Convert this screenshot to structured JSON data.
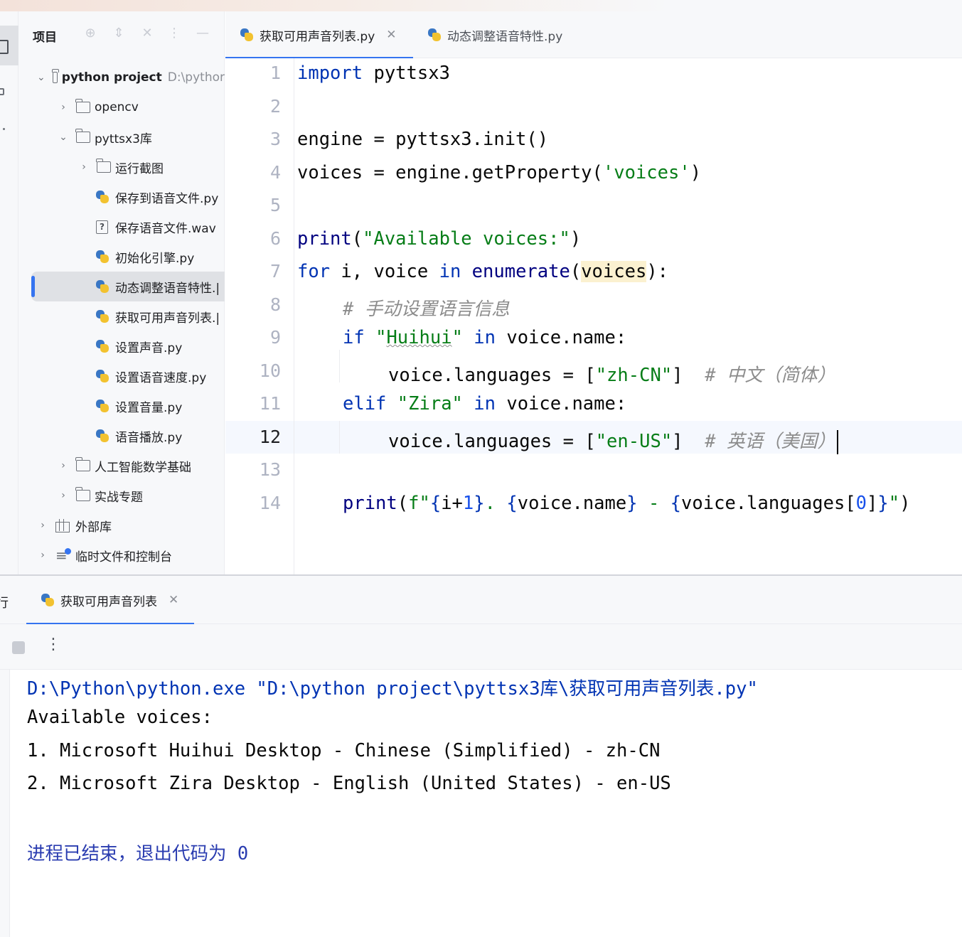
{
  "project_panel": {
    "title": "项目",
    "tree": [
      {
        "label": "python project",
        "path": "D:\\pythor",
        "type": "folder",
        "expanded": true
      },
      {
        "label": "opencv",
        "type": "folder",
        "expanded": false
      },
      {
        "label": "pyttsx3库",
        "type": "folder",
        "expanded": true
      },
      {
        "label": "运行截图",
        "type": "folder",
        "expanded": false
      },
      {
        "label": "保存到语音文件.py",
        "type": "python-file"
      },
      {
        "label": "保存语音文件.wav",
        "type": "unknown-file"
      },
      {
        "label": "初始化引擎.py",
        "type": "python-file"
      },
      {
        "label": "动态调整语音特性.|",
        "type": "python-file",
        "selected": true
      },
      {
        "label": "获取可用声音列表.|",
        "type": "python-file"
      },
      {
        "label": "设置声音.py",
        "type": "python-file"
      },
      {
        "label": "设置语音速度.py",
        "type": "python-file"
      },
      {
        "label": "设置音量.py",
        "type": "python-file"
      },
      {
        "label": "语音播放.py",
        "type": "python-file"
      },
      {
        "label": "人工智能数学基础",
        "type": "folder",
        "expanded": false
      },
      {
        "label": "实战专题",
        "type": "folder",
        "expanded": false
      },
      {
        "label": "外部库",
        "type": "library",
        "expanded": false
      },
      {
        "label": "临时文件和控制台",
        "type": "scratch",
        "expanded": false
      }
    ]
  },
  "editor_tabs": [
    {
      "label": "获取可用声音列表.py",
      "active": true
    },
    {
      "label": "动态调整语音特性.py",
      "active": false
    }
  ],
  "editor": {
    "line_numbers": [
      "1",
      "2",
      "3",
      "4",
      "5",
      "6",
      "7",
      "8",
      "9",
      "10",
      "11",
      "12",
      "13",
      "14"
    ],
    "current_line": "12",
    "code": {
      "l1_kw": "import",
      "l1_rest": " pyttsx3",
      "l3": "engine = pyttsx3.init()",
      "l4_a": "voices = engine.getProperty(",
      "l4_str": "'voices'",
      "l4_b": ")",
      "l6_fn": "print",
      "l6_a": "(",
      "l6_str": "\"Available voices:\"",
      "l6_b": ")",
      "l7_kw1": "for",
      "l7_a": " i, voice ",
      "l7_kw2": "in",
      "l7_sp": " ",
      "l7_fn": "enumerate",
      "l7_b": "(",
      "l7_hl": "voices",
      "l7_c": "):",
      "l8_cmt": "# 手动设置语言信息",
      "l9_kw1": "if",
      "l9_sp": " ",
      "l9_q1": "\"",
      "l9_str": "Huihui",
      "l9_q2": "\"",
      "l9_sp2": " ",
      "l9_kw2": "in",
      "l9_rest": " voice.name:",
      "l10_a": "voice.languages = [",
      "l10_str": "\"zh-CN\"",
      "l10_b": "]  ",
      "l10_cmt": "# 中文（简体）",
      "l11_kw1": "elif",
      "l11_sp": " ",
      "l11_str": "\"Zira\"",
      "l11_sp2": " ",
      "l11_kw2": "in",
      "l11_rest": " voice.name:",
      "l12_a": "voice.languages = [",
      "l12_str": "\"en-US\"",
      "l12_b": "]  ",
      "l12_cmt": "# 英语（美国）",
      "l14_fn": "print",
      "l14_a": "(",
      "l14_f": "f\"",
      "l14_b1": "{",
      "l14_i": "i+",
      "l14_one": "1",
      "l14_b2": "}",
      "l14_dot": ". ",
      "l14_b3": "{",
      "l14_vn": "voice.name",
      "l14_b4": "}",
      "l14_dash": " - ",
      "l14_b5": "{",
      "l14_vl": "voice.languages[",
      "l14_zero": "0",
      "l14_vl2": "]",
      "l14_b6": "}",
      "l14_q": "\"",
      "l14_end": ")"
    }
  },
  "run_panel": {
    "left_label": "行",
    "tab_label": "获取可用声音列表",
    "output": [
      "D:\\Python\\python.exe \"D:\\python project\\pyttsx3库\\获取可用声音列表.py\"",
      "Available voices:",
      "1. Microsoft Huihui Desktop - Chinese (Simplified) - zh-CN",
      "2. Microsoft Zira Desktop - English (United States) - en-US",
      "",
      "进程已结束，退出代码为 0"
    ]
  },
  "colors": {
    "accent": "#3574f0",
    "keyword": "#0033b3",
    "string": "#067d17",
    "comment": "#8c8c8c",
    "number": "#1750eb"
  }
}
